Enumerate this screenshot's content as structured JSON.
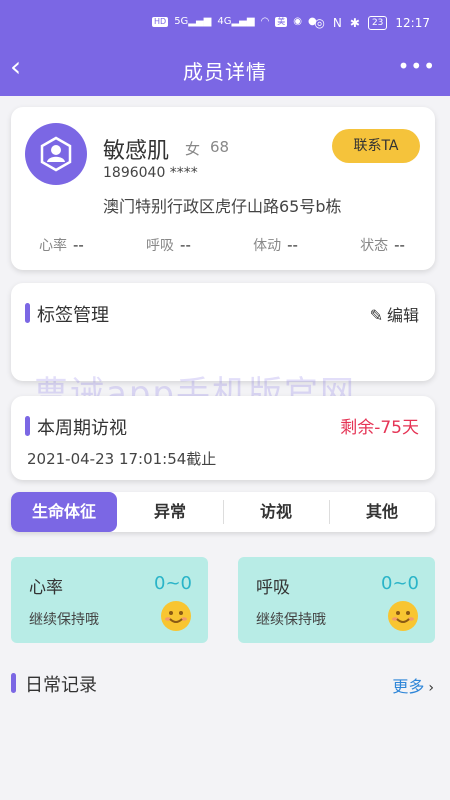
{
  "status_bar": {
    "time": "12:17",
    "battery": "23",
    "indicators": [
      "HD",
      "HD",
      "5G",
      "4G",
      "wifi",
      "美",
      "wechat",
      "message",
      "eye",
      "nfc",
      "bluetooth"
    ]
  },
  "header": {
    "title": "成员详情",
    "back_icon": "chevron-left-icon",
    "more_icon": "more-dots-icon"
  },
  "profile": {
    "name": "敏感肌",
    "gender": "女",
    "age": "68",
    "phone": "1896040 ****",
    "address": "澳门特别行政区虎仔山路65号b栋",
    "contact_label": "联系TA",
    "stats": [
      {
        "label": "心率",
        "value": "--"
      },
      {
        "label": "呼吸",
        "value": "--"
      },
      {
        "label": "体动",
        "value": "--"
      },
      {
        "label": "状态",
        "value": "--"
      }
    ]
  },
  "tags": {
    "title": "标签管理",
    "edit_label": "编辑"
  },
  "watermark": "曹诫app手机版官网",
  "visit": {
    "title": "本周期访视",
    "remaining": "剩余-75天",
    "deadline": "2021-04-23 17:01:54截止"
  },
  "tabs": [
    {
      "label": "生命体征",
      "active": true
    },
    {
      "label": "异常",
      "active": false
    },
    {
      "label": "访视",
      "active": false
    },
    {
      "label": "其他",
      "active": false
    }
  ],
  "vitals": [
    {
      "name": "心率",
      "value": "0~0",
      "tip": "继续保持哦"
    },
    {
      "name": "呼吸",
      "value": "0~0",
      "tip": "继续保持哦"
    }
  ],
  "daily": {
    "title": "日常记录",
    "more_label": "更多"
  },
  "colors": {
    "primary": "#7b67e4",
    "contact_btn": "#f5c33b",
    "vital_bg": "#b8ece6",
    "remaining": "#e53455",
    "link": "#2f86d8"
  }
}
